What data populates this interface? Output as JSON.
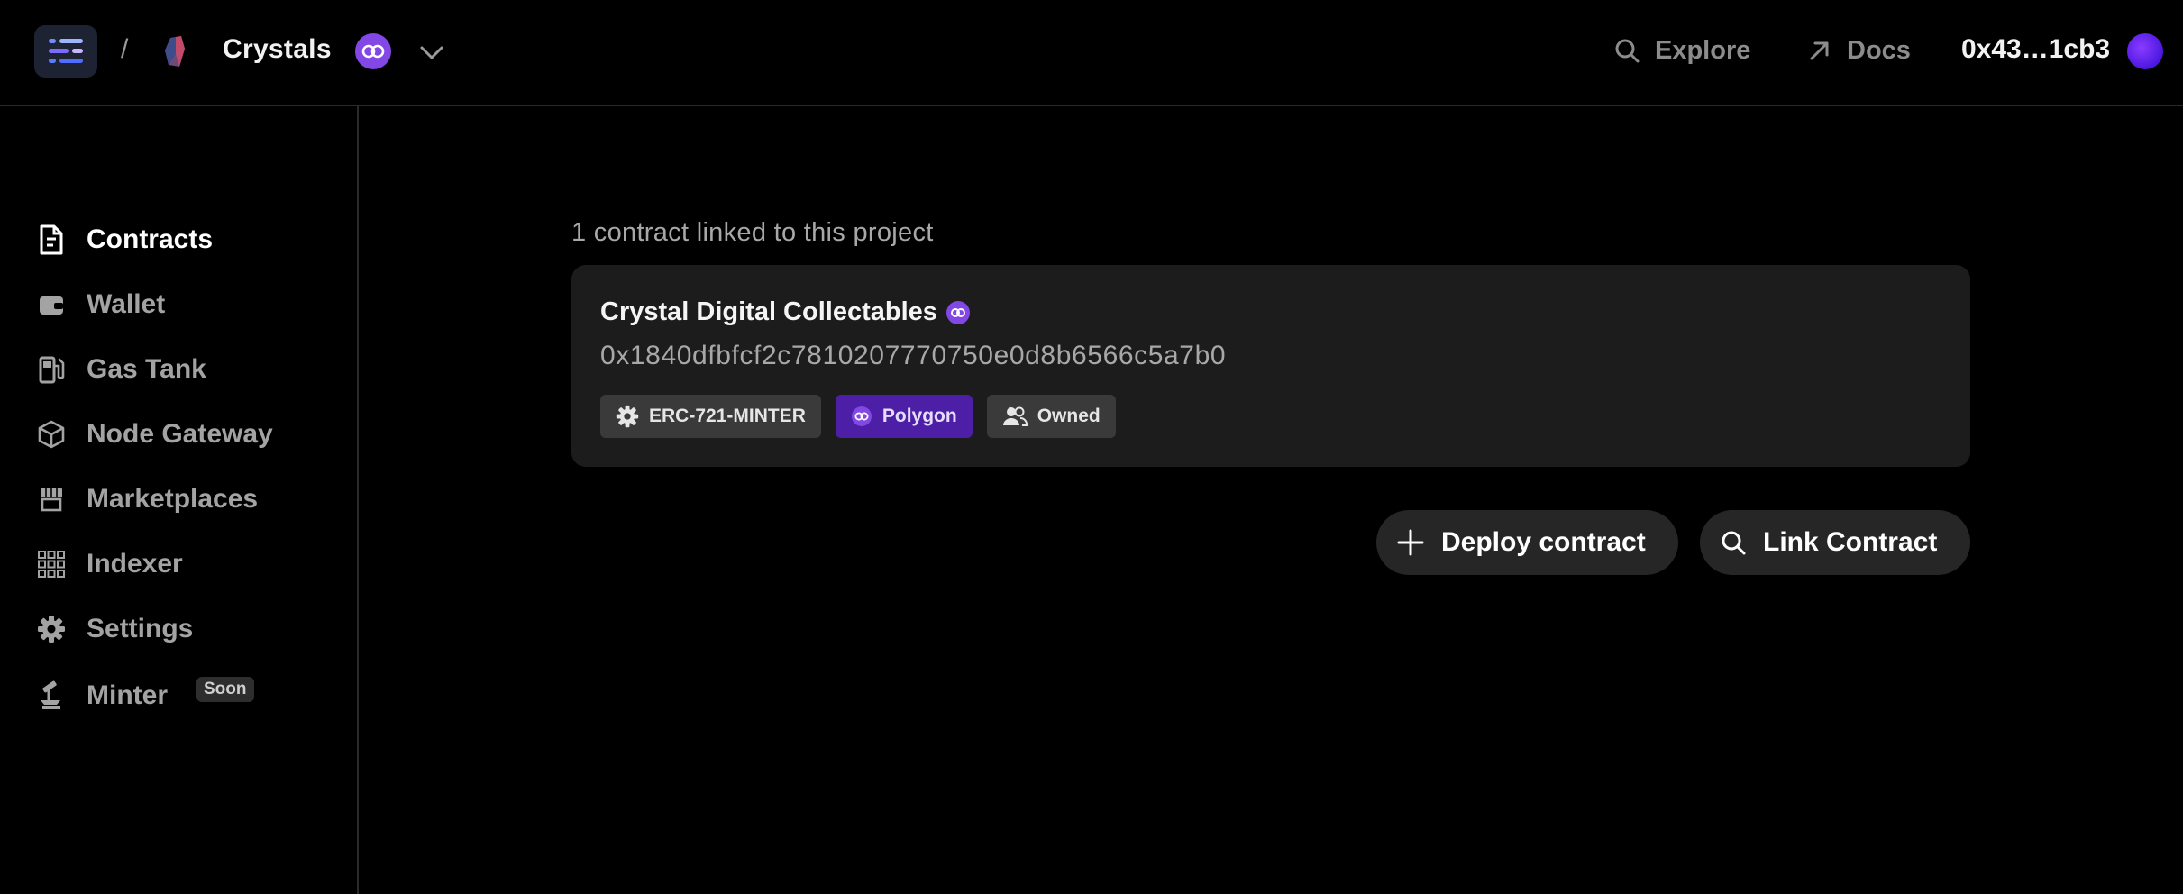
{
  "header": {
    "breadcrumb_separator": "/",
    "project_name": "Crystals",
    "nav": {
      "explore_label": "Explore",
      "docs_label": "Docs"
    },
    "wallet_address": "0x43…1cb3"
  },
  "sidebar": {
    "items": [
      {
        "label": "Contracts",
        "icon": "contract-icon",
        "active": true
      },
      {
        "label": "Wallet",
        "icon": "wallet-icon"
      },
      {
        "label": "Gas Tank",
        "icon": "gas-pump-icon"
      },
      {
        "label": "Node Gateway",
        "icon": "cube-icon"
      },
      {
        "label": "Marketplaces",
        "icon": "storefront-icon"
      },
      {
        "label": "Indexer",
        "icon": "grid-icon"
      },
      {
        "label": "Settings",
        "icon": "gear-icon"
      },
      {
        "label": "Minter",
        "icon": "minter-icon",
        "badge": "Soon"
      }
    ]
  },
  "main": {
    "linked_count_text": "1 contract linked to this project",
    "contract": {
      "name": "Crystal Digital Collectables",
      "address": "0x1840dfbfcf2c7810207770750e0d8b6566c5a7b0",
      "tags": {
        "standard": "ERC-721-MINTER",
        "chain": "Polygon",
        "ownership": "Owned"
      }
    },
    "actions": {
      "deploy_label": "Deploy contract",
      "link_label": "Link Contract"
    }
  },
  "colors": {
    "background": "#000000",
    "card": "#1c1c1c",
    "polygon_purple": "#8247e5",
    "muted_text": "#a3a3a3"
  }
}
